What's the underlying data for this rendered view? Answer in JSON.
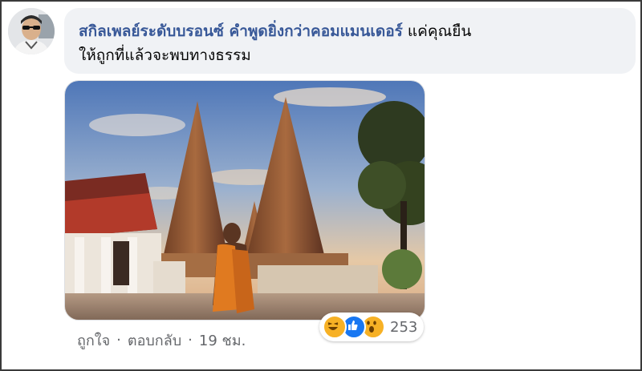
{
  "comment": {
    "author": "สกิลเพลย์ระดับบรอนซ์ คำพูดยิ่งกว่าคอมแมนเดอร์",
    "text_line1": "แค่คุณยืน",
    "text_line2": "ให้ถูกที่แล้วจะพบทางธรรม"
  },
  "actions": {
    "like": "ถูกใจ",
    "reply": "ตอบกลับ",
    "time": "19 ชม."
  },
  "reactions": {
    "icons": [
      "haha-icon",
      "like-icon",
      "wow-icon"
    ],
    "count": "253",
    "colors": {
      "haha": "#f7b125",
      "like": "#1877f2",
      "wow": "#f7b125"
    }
  },
  "accent": "#385898"
}
